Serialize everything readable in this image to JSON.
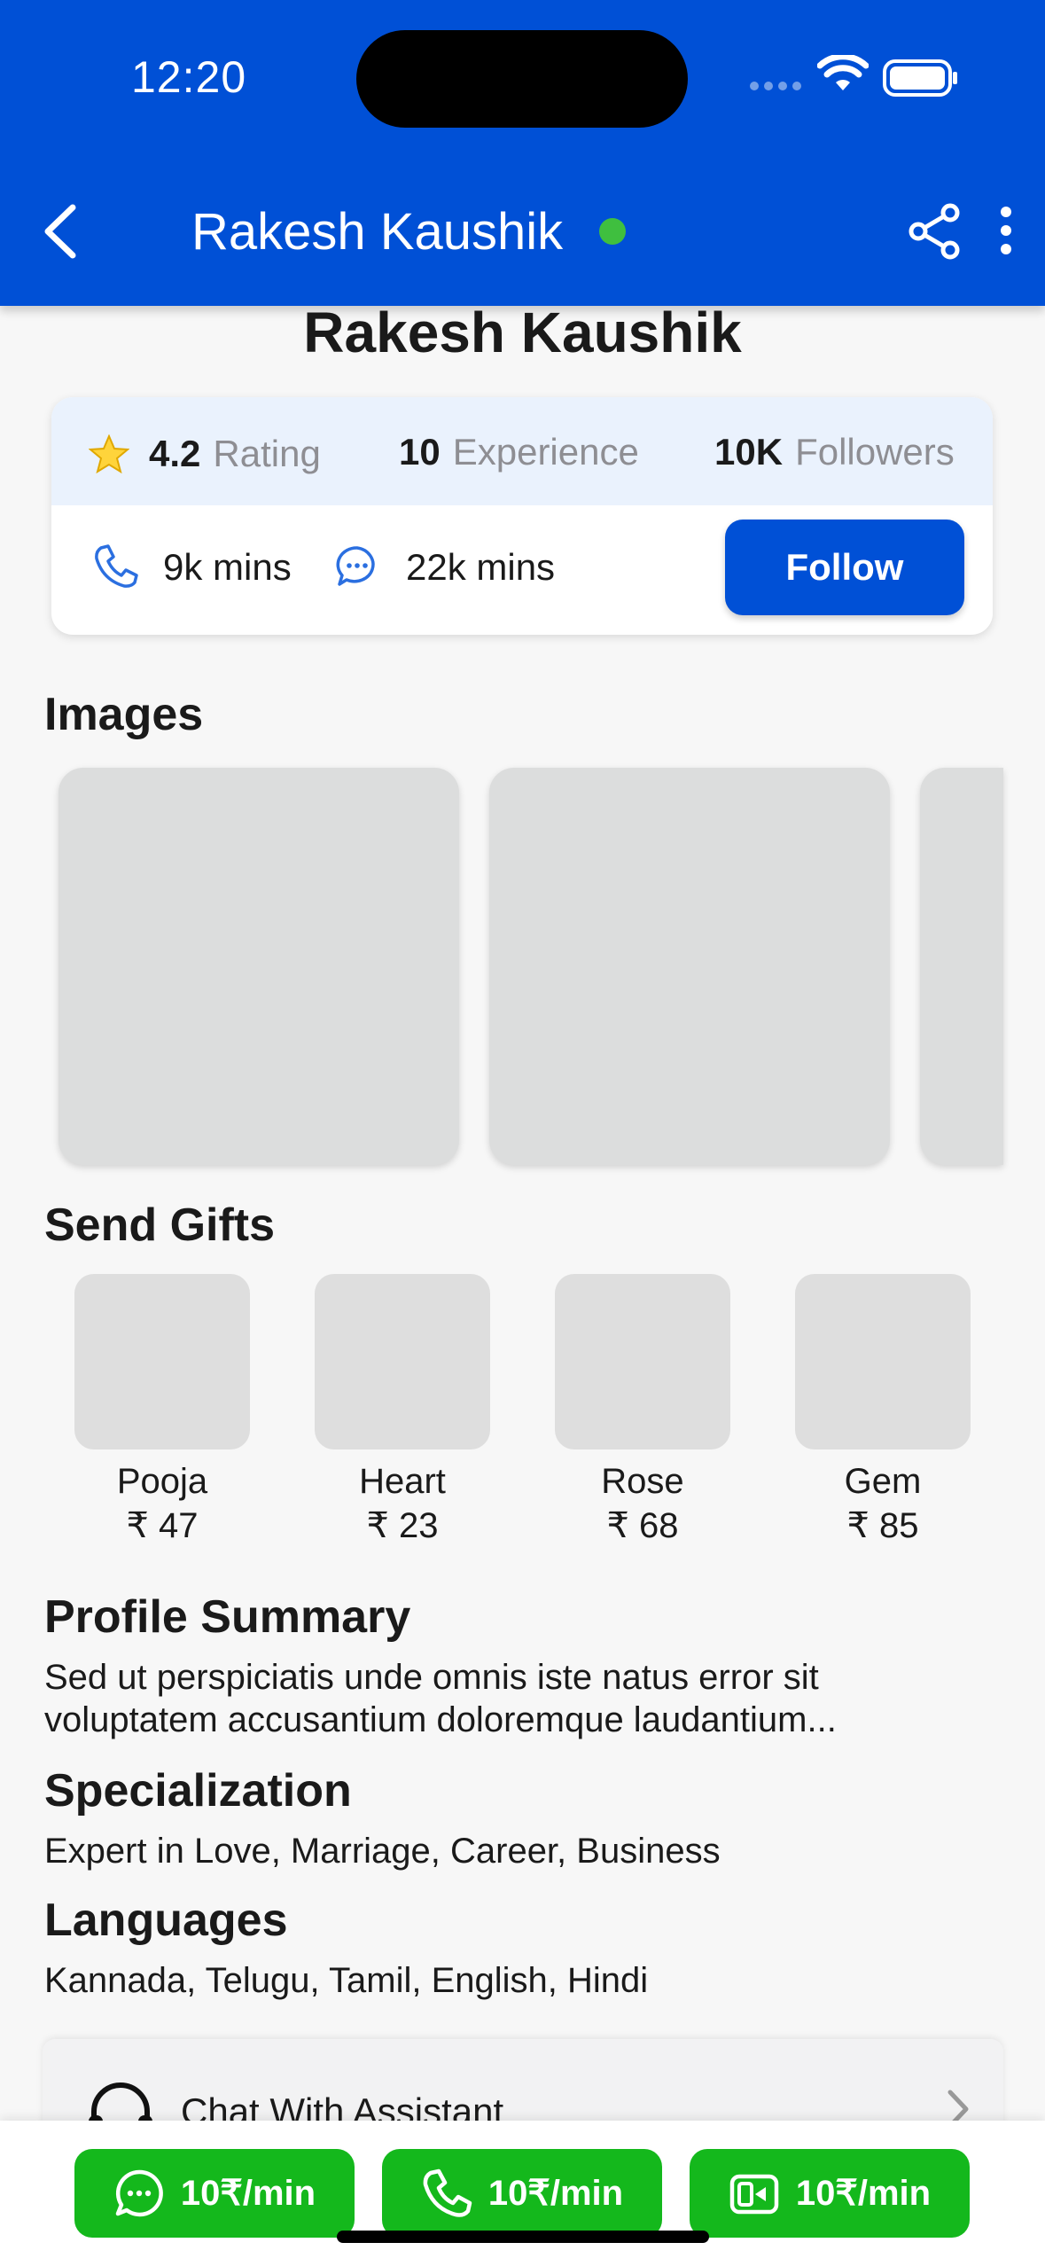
{
  "status_bar": {
    "time": "12:20"
  },
  "nav": {
    "title": "Rakesh Kaushik"
  },
  "profile": {
    "name": "Rakesh Kaushik",
    "rating_value": "4.2",
    "rating_label": "Rating",
    "experience_value": "10",
    "experience_label": "Experience",
    "followers_value": "10K",
    "followers_label": "Followers",
    "call_mins": "9k mins",
    "chat_mins": "22k mins",
    "follow_label": "Follow"
  },
  "sections": {
    "images": "Images",
    "gifts": "Send Gifts",
    "summary_title": "Profile Summary",
    "summary_line1": "Sed ut perspiciatis unde omnis iste natus error sit",
    "summary_line2": "voluptatem accusantium doloremque laudantium...",
    "specialization_title": "Specialization",
    "specialization_text": "Expert in Love, Marriage, Career, Business",
    "languages_title": "Languages",
    "languages_text": "Kannada, Telugu, Tamil, English, Hindi"
  },
  "gifts": [
    {
      "name": "Pooja",
      "price": "₹ 47"
    },
    {
      "name": "Heart",
      "price": "₹ 23"
    },
    {
      "name": "Rose",
      "price": "₹ 68"
    },
    {
      "name": "Gem",
      "price": "₹ 85"
    }
  ],
  "assistant": {
    "label": "Chat With Assistant"
  },
  "actions": {
    "chat_price": "10₹/min",
    "call_price": "10₹/min",
    "video_price": "10₹/min"
  },
  "colors": {
    "primary": "#0050d6",
    "green": "#14b81c",
    "online": "#3fbf3f"
  }
}
